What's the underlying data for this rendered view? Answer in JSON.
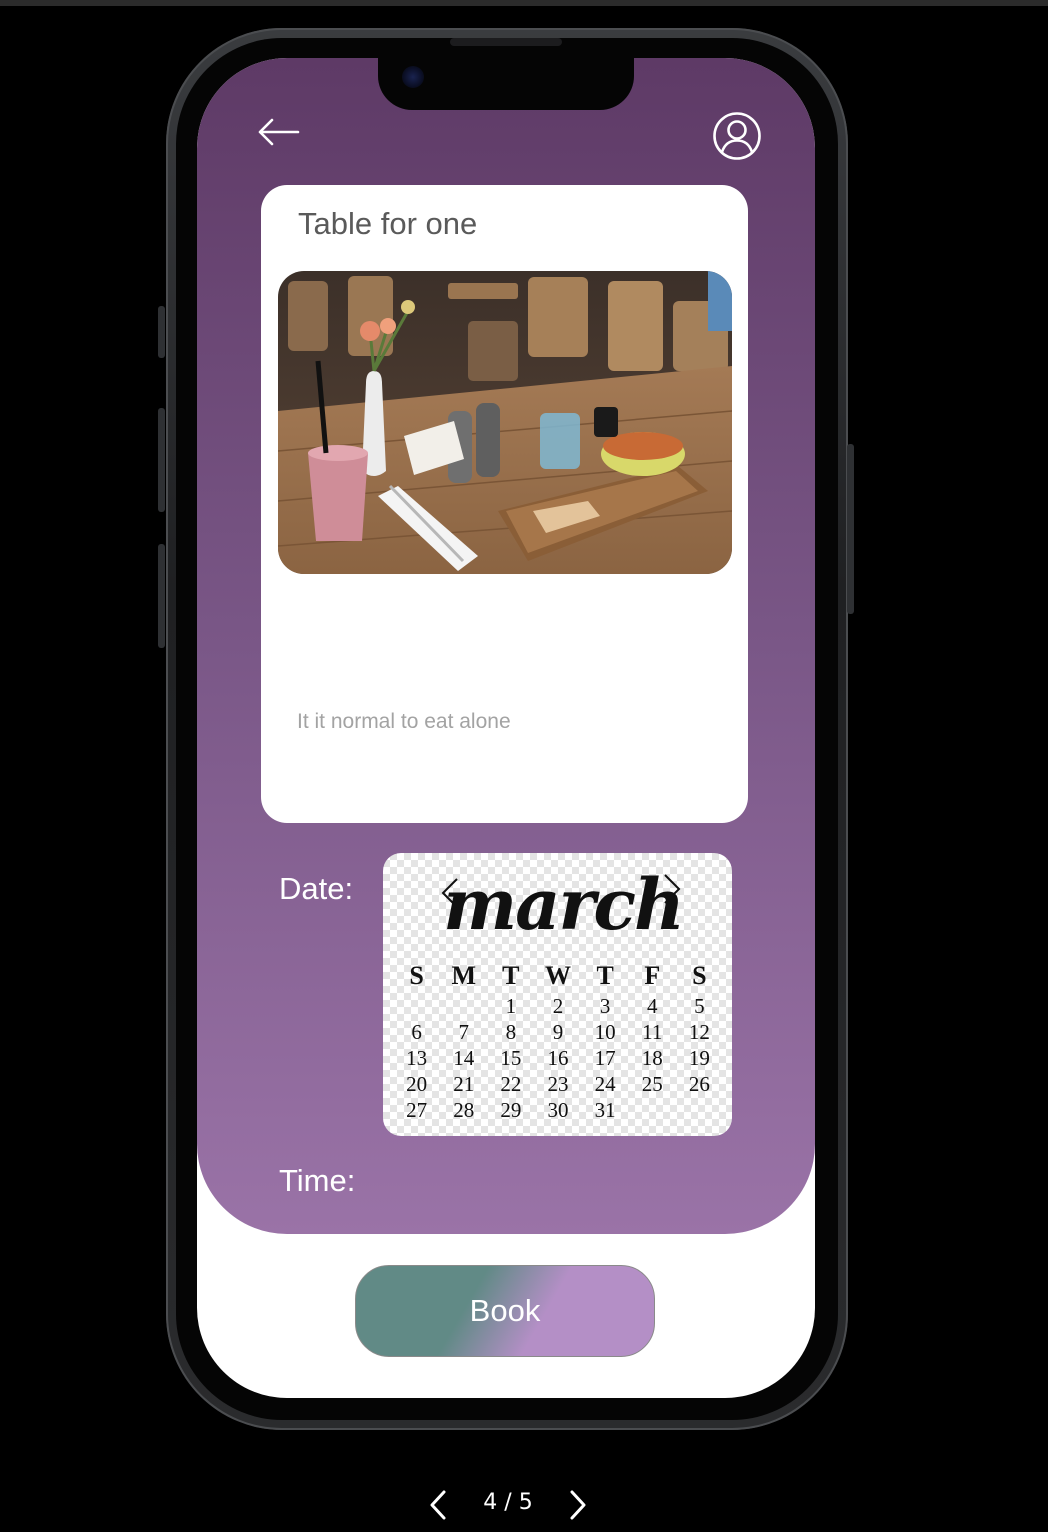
{
  "card": {
    "title": "Table for one",
    "description": "It it normal to eat alone"
  },
  "form": {
    "date_label": "Date:",
    "time_label": "Time:"
  },
  "calendar": {
    "month": "march",
    "weekdays": [
      "S",
      "M",
      "T",
      "W",
      "T",
      "F",
      "S"
    ],
    "days": [
      "",
      "",
      "1",
      "2",
      "3",
      "4",
      "5",
      "6",
      "7",
      "8",
      "9",
      "10",
      "11",
      "12",
      "13",
      "14",
      "15",
      "16",
      "17",
      "18",
      "19",
      "20",
      "21",
      "22",
      "23",
      "24",
      "25",
      "26",
      "27",
      "28",
      "29",
      "30",
      "31",
      "",
      ""
    ]
  },
  "actions": {
    "book_label": "Book"
  },
  "pager": {
    "text": "4 / 5"
  },
  "icons": {
    "back": "arrow-left-icon",
    "profile": "user-circle-icon",
    "prev_month": "chevron-left-icon",
    "next_month": "chevron-right-icon"
  },
  "colors": {
    "header_top": "#5e3a66",
    "header_bottom": "#9a73a7",
    "book_green": "#618a86",
    "book_lilac": "#b48fc6"
  }
}
